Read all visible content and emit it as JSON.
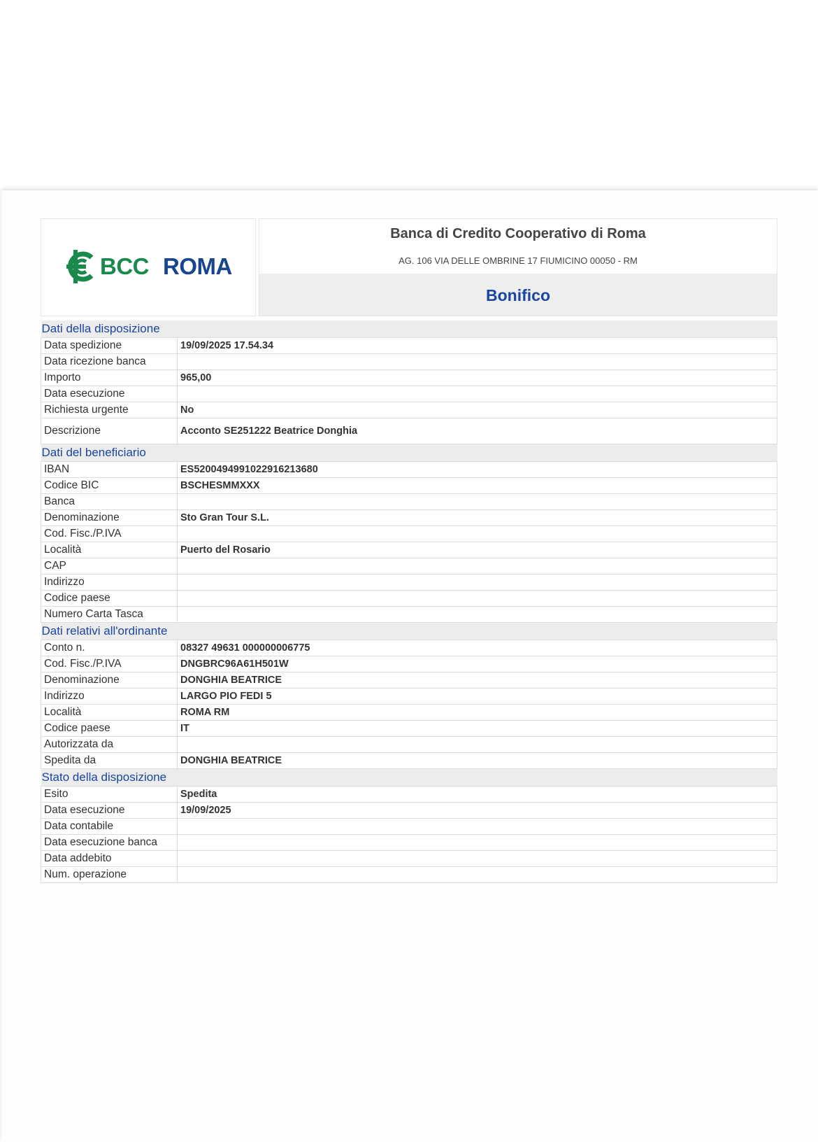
{
  "header": {
    "logo_bcc": "BCC",
    "logo_roma": "ROMA",
    "bank_name": "Banca di Credito Cooperativo di Roma",
    "bank_address": "AG. 106 VIA DELLE OMBRINE 17 FIUMICINO 00050 - RM",
    "doc_title": "Bonifico"
  },
  "sections": {
    "disposizione": {
      "title": "Dati della disposizione",
      "rows": [
        {
          "label": "Data spedizione",
          "value": "19/09/2025 17.54.34"
        },
        {
          "label": "Data ricezione banca",
          "value": ""
        },
        {
          "label": "Importo",
          "value": "965,00"
        },
        {
          "label": "Data esecuzione",
          "value": ""
        },
        {
          "label": "Richiesta urgente",
          "value": "No"
        },
        {
          "label": "Descrizione",
          "value": "Acconto  SE251222 Beatrice Donghia"
        }
      ]
    },
    "beneficiario": {
      "title": "Dati del beneficiario",
      "rows": [
        {
          "label": "IBAN",
          "value": "ES5200494991022916213680"
        },
        {
          "label": "Codice BIC",
          "value": "BSCHESMMXXX"
        },
        {
          "label": "Banca",
          "value": ""
        },
        {
          "label": "Denominazione",
          "value": "Sto Gran Tour S.L."
        },
        {
          "label": "Cod. Fisc./P.IVA",
          "value": ""
        },
        {
          "label": "Località",
          "value": "Puerto del Rosario"
        },
        {
          "label": "CAP",
          "value": ""
        },
        {
          "label": "Indirizzo",
          "value": ""
        },
        {
          "label": "Codice paese",
          "value": ""
        },
        {
          "label": "Numero Carta Tasca",
          "value": ""
        }
      ]
    },
    "ordinante": {
      "title": "Dati relativi all'ordinante",
      "rows": [
        {
          "label": "Conto n.",
          "value": "08327 49631 000000006775"
        },
        {
          "label": "Cod. Fisc./P.IVA",
          "value": "DNGBRC96A61H501W"
        },
        {
          "label": "Denominazione",
          "value": "DONGHIA BEATRICE"
        },
        {
          "label": "Indirizzo",
          "value": "LARGO PIO FEDI 5"
        },
        {
          "label": "Località",
          "value": "ROMA RM"
        },
        {
          "label": "Codice paese",
          "value": "IT"
        },
        {
          "label": "Autorizzata da",
          "value": ""
        },
        {
          "label": "Spedita da",
          "value": "DONGHIA BEATRICE"
        }
      ]
    },
    "stato": {
      "title": "Stato della disposizione",
      "rows": [
        {
          "label": "Esito",
          "value": "Spedita"
        },
        {
          "label": "Data esecuzione",
          "value": "19/09/2025"
        },
        {
          "label": "Data contabile",
          "value": ""
        },
        {
          "label": "Data esecuzione banca",
          "value": ""
        },
        {
          "label": "Data addebito",
          "value": ""
        },
        {
          "label": "Num. operazione",
          "value": ""
        }
      ]
    }
  },
  "colors": {
    "brand_green": "#1a8a4c",
    "brand_blue": "#17468f",
    "section_title": "#1a46a0",
    "section_band": "#ececec"
  }
}
